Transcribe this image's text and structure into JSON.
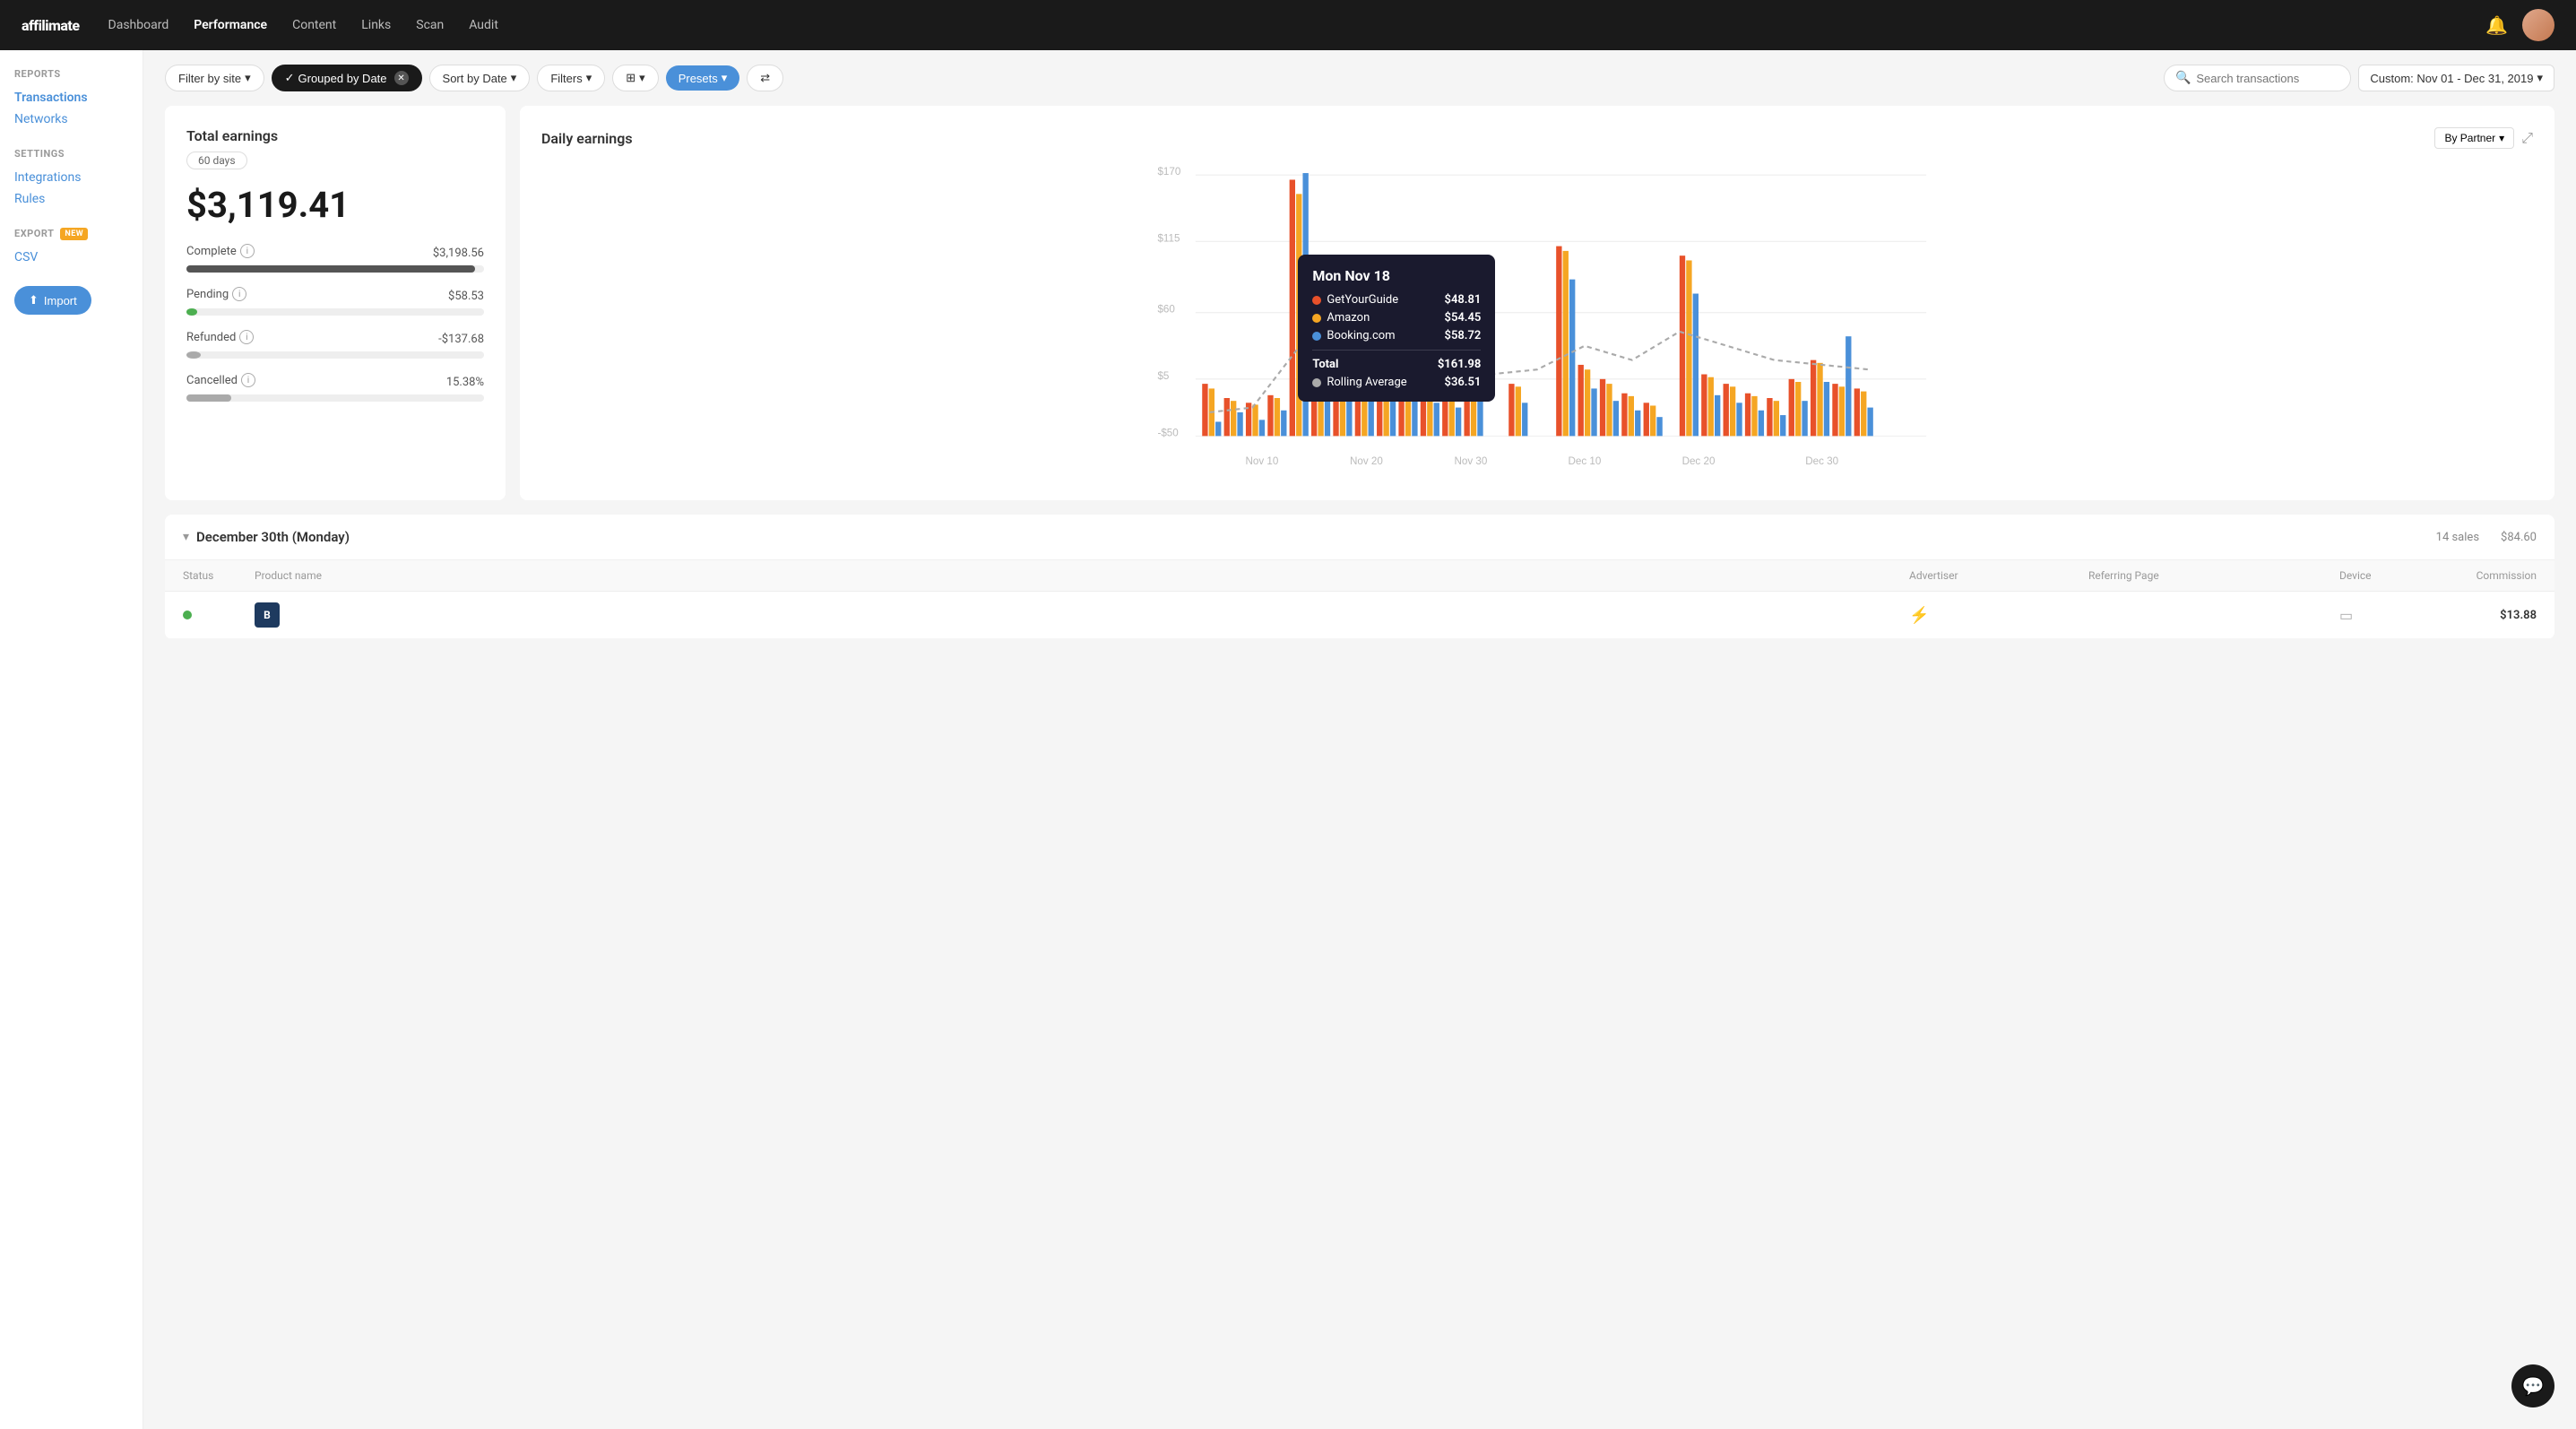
{
  "nav": {
    "logo": "affilimate",
    "links": [
      {
        "label": "Dashboard",
        "active": false
      },
      {
        "label": "Performance",
        "active": true
      },
      {
        "label": "Content",
        "active": false
      },
      {
        "label": "Links",
        "active": false
      },
      {
        "label": "Scan",
        "active": false
      },
      {
        "label": "Audit",
        "active": false
      }
    ]
  },
  "sidebar": {
    "reports_title": "REPORTS",
    "reports_links": [
      {
        "label": "Transactions",
        "active": true
      },
      {
        "label": "Networks",
        "active": false
      }
    ],
    "settings_title": "SETTINGS",
    "settings_links": [
      {
        "label": "Integrations",
        "active": false
      },
      {
        "label": "Rules",
        "active": false
      }
    ],
    "export_title": "EXPORT",
    "export_badge": "NEW",
    "export_links": [
      {
        "label": "CSV",
        "active": false
      }
    ],
    "import_label": "Import"
  },
  "toolbar": {
    "filter_by_site": "Filter by site",
    "grouped_by_date": "Grouped by Date",
    "sort_by_date": "Sort by Date",
    "filters": "Filters",
    "columns": "",
    "presets": "Presets",
    "search_placeholder": "Search transactions",
    "date_range": "Custom: Nov 01 - Dec 31, 2019"
  },
  "earnings_card": {
    "title": "Total earnings",
    "days": "60 days",
    "total": "$3,119.41",
    "complete_label": "Complete",
    "complete_value": "$3,198.56",
    "complete_pct": 97,
    "pending_label": "Pending",
    "pending_value": "$58.53",
    "pending_pct": 2,
    "refunded_label": "Refunded",
    "refunded_value": "-$137.68",
    "refunded_pct": 4,
    "cancelled_label": "Cancelled",
    "cancelled_value": "15.38%",
    "cancelled_pct": 15
  },
  "chart": {
    "title": "Daily earnings",
    "by_partner": "By Partner",
    "y_labels": [
      "$170",
      "$115",
      "$60",
      "$5",
      "-$50"
    ],
    "x_labels": [
      "Nov 10",
      "Nov 20",
      "Nov 30",
      "Dec 10",
      "Dec 20",
      "Dec 30"
    ],
    "tooltip": {
      "date": "Mon Nov 18",
      "rows": [
        {
          "color": "#e8512a",
          "label": "GetYourGuide",
          "amount": "$48.81"
        },
        {
          "color": "#f5a623",
          "label": "Amazon",
          "amount": "$54.45"
        },
        {
          "color": "#4a90d9",
          "label": "Booking.com",
          "amount": "$58.72"
        }
      ],
      "total_label": "Total",
      "total_amount": "$161.98",
      "avg_label": "Rolling Average",
      "avg_amount": "$36.51"
    }
  },
  "transactions": {
    "group_date": "December 30th (Monday)",
    "group_sales": "14 sales",
    "group_amount": "$84.60",
    "table_headers": [
      "Status",
      "Product name",
      "Advertiser",
      "Referring Page",
      "Device",
      "Commission"
    ],
    "row": {
      "status_color": "#4caf50",
      "product_icon": "B",
      "advertiser_icon": "⚡",
      "advertiser_color": "#4a90d9",
      "device_icon": "▭",
      "commission": "$13.88"
    }
  }
}
